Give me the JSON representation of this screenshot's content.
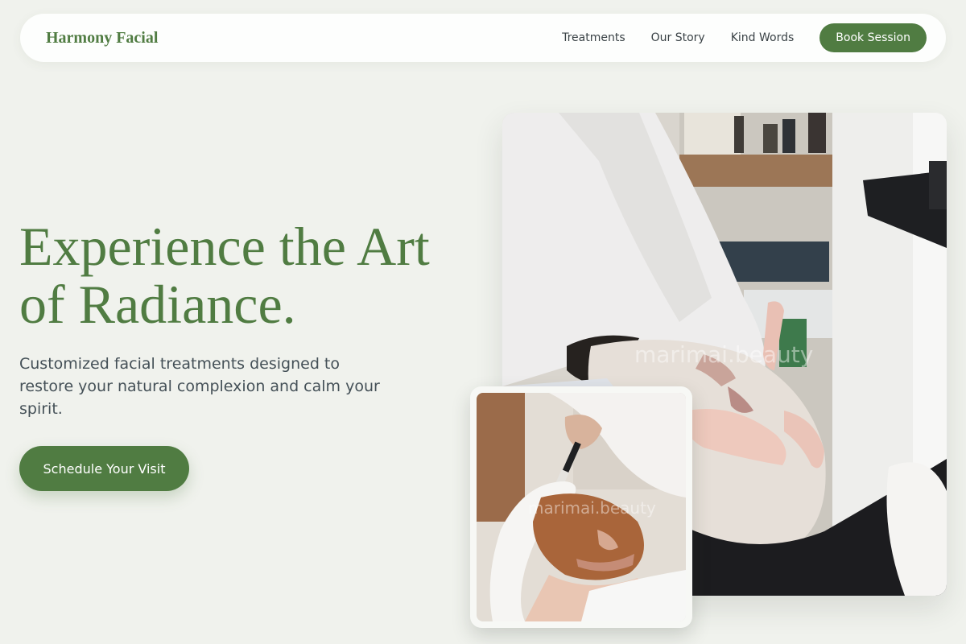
{
  "brand": {
    "name": "Harmony Facial"
  },
  "nav": {
    "links": [
      "Treatments",
      "Our Story",
      "Kind Words"
    ],
    "cta_label": "Book Session"
  },
  "hero": {
    "title_line1": "Experience the Art",
    "title_line2": "of Radiance.",
    "subtitle": "Customized facial treatments designed to restore your natural complexion and calm your spirit.",
    "cta_label": "Schedule Your Visit"
  },
  "images": {
    "main_watermark": "marimai.beauty",
    "secondary_watermark": "marimai.beauty"
  },
  "colors": {
    "accent": "#507c42",
    "background": "#f0f2ed",
    "card": "#fdfefd",
    "body_text": "#445057"
  }
}
